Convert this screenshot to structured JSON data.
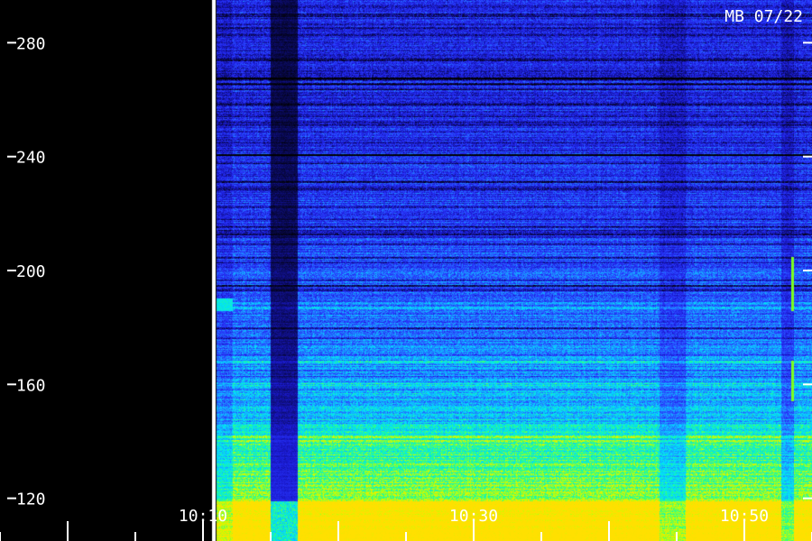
{
  "chart_data": {
    "type": "heatmap",
    "annotation": "MB 07/22",
    "y_axis": {
      "ticks": [
        {
          "value": 120,
          "label": "120"
        },
        {
          "value": 160,
          "label": "160"
        },
        {
          "value": 200,
          "label": "200"
        },
        {
          "value": 240,
          "label": "240"
        },
        {
          "value": 280,
          "label": "280"
        }
      ],
      "range": [
        105,
        295
      ],
      "side": "left and right"
    },
    "x_axis": {
      "labels": [
        "10:10",
        "10:30",
        "10:50"
      ],
      "label_minutes": [
        10,
        30,
        50
      ],
      "range_minutes": [
        -5,
        55
      ],
      "minor_ticks_minutes": [
        -5,
        0,
        5,
        10,
        15,
        20,
        25,
        30,
        35,
        40,
        45,
        50,
        55
      ]
    },
    "data_segments": [
      {
        "start_min": 11.0,
        "end_min": 12.2,
        "quality": "partial"
      },
      {
        "start_min": 12.2,
        "end_min": 15.0,
        "quality": "good"
      },
      {
        "start_min": 15.0,
        "end_min": 17.0,
        "quality": "weak"
      },
      {
        "start_min": 17.0,
        "end_min": 55.0,
        "quality": "good"
      }
    ],
    "no_data_ranges_min": [
      [
        -5,
        10.6
      ],
      [
        10.6,
        11.0
      ]
    ],
    "divider_min": 10.8,
    "colormap": [
      "#000000",
      "#0a0a5a",
      "#1a1ad0",
      "#2a3aff",
      "#1e90ff",
      "#00e0ff",
      "#20ff90",
      "#c8ff00",
      "#ffe000"
    ]
  }
}
